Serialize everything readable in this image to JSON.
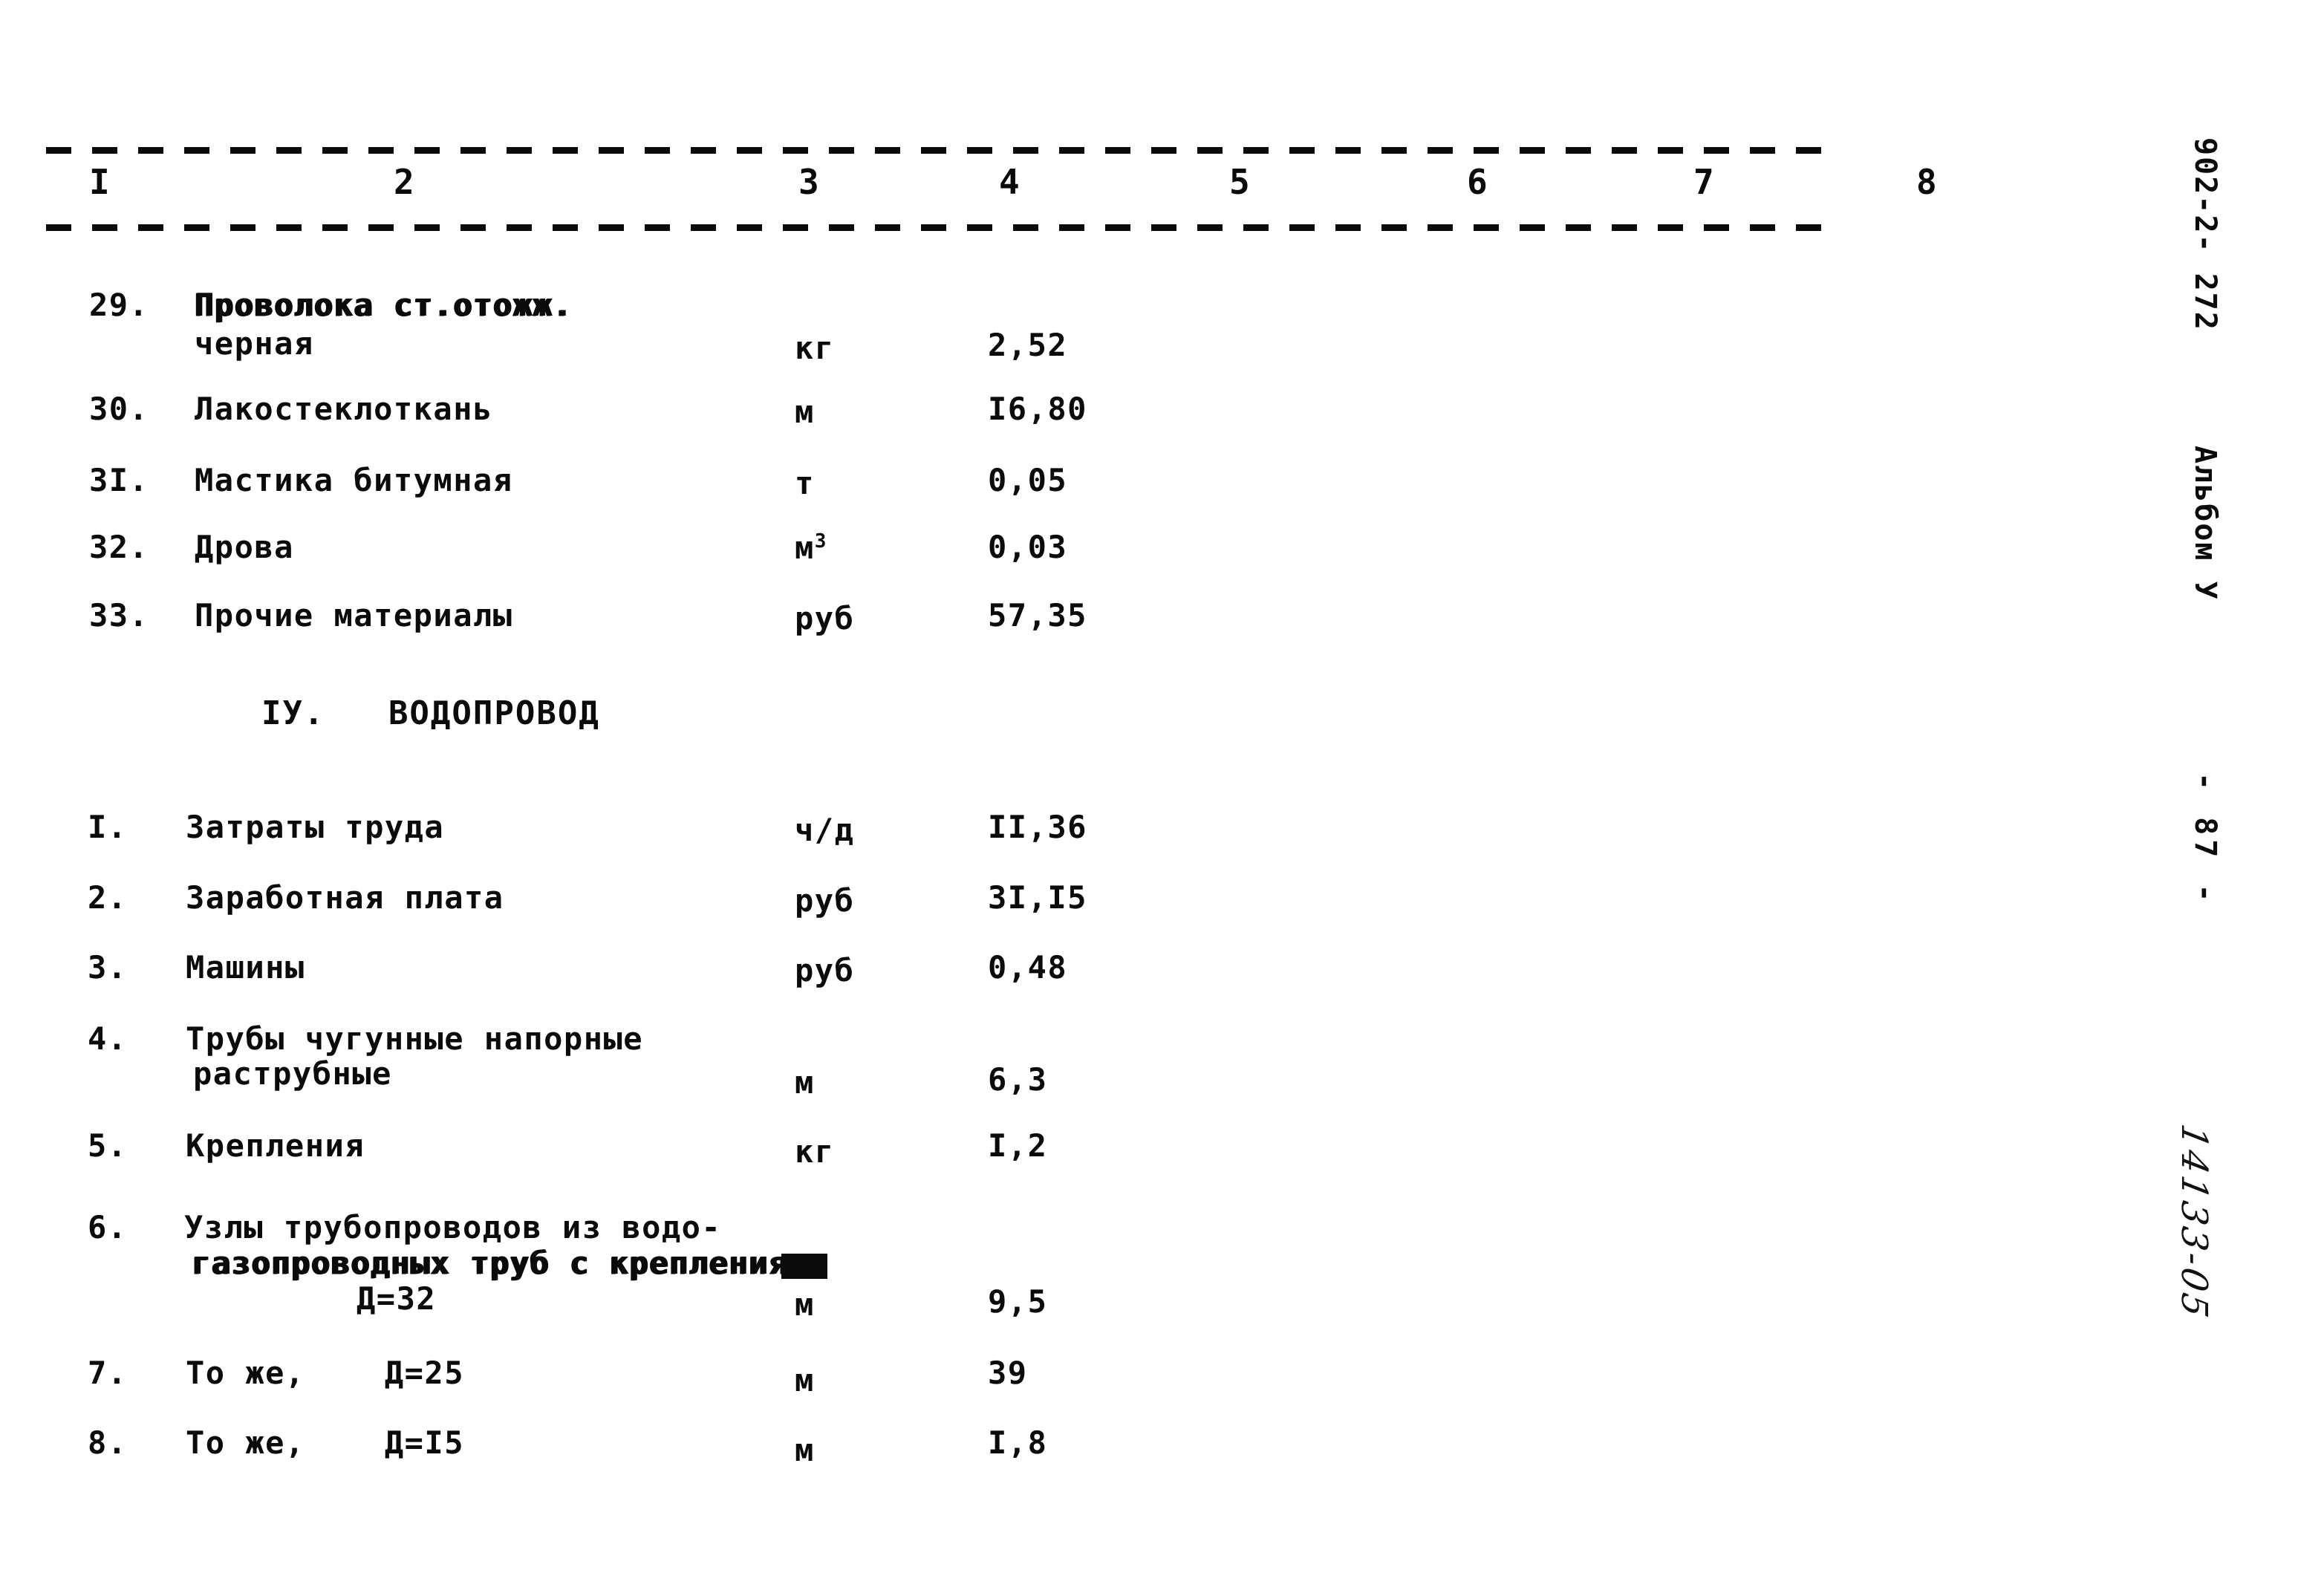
{
  "document": {
    "column_headers": [
      "I",
      "2",
      "3",
      "4",
      "5",
      "6",
      "7",
      "8"
    ],
    "section_heading": "IУ.   ВОДОПРОВОД",
    "rows_before_section": [
      {
        "num": "29.",
        "name_line1": "Проволока ст.отожж.",
        "name_line2": "черная",
        "unit": "кг",
        "unit_sup": "",
        "value": "2,52"
      },
      {
        "num": "30.",
        "name_line1": "Лакостеклоткань",
        "name_line2": "",
        "unit": "м",
        "unit_sup": "",
        "value": "I6,80"
      },
      {
        "num": "3I.",
        "name_line1": "Мастика битумная",
        "name_line2": "",
        "unit": "т",
        "unit_sup": "",
        "value": "0,05"
      },
      {
        "num": "32.",
        "name_line1": "Дрова",
        "name_line2": "",
        "unit": "м",
        "unit_sup": "3",
        "value": "0,03"
      },
      {
        "num": "33.",
        "name_line1": "Прочие материалы",
        "name_line2": "",
        "unit": "руб",
        "unit_sup": "",
        "value": "57,35"
      }
    ],
    "rows_after_section": [
      {
        "num": "I.",
        "name_line1": "Затраты труда",
        "name_line2": "",
        "name_line3": "",
        "unit": "ч/д",
        "unit_sup": "",
        "value": "II,36"
      },
      {
        "num": "2.",
        "name_line1": "Заработная плата",
        "name_line2": "",
        "name_line3": "",
        "unit": "руб",
        "unit_sup": "",
        "value": "3I,I5"
      },
      {
        "num": "3.",
        "name_line1": "Машины",
        "name_line2": "",
        "name_line3": "",
        "unit": "руб",
        "unit_sup": "",
        "value": "0,48"
      },
      {
        "num": "4.",
        "name_line1": "Трубы чугунные напорные",
        "name_line2": "раструбные",
        "name_line3": "",
        "unit": "м",
        "unit_sup": "",
        "value": "6,3"
      },
      {
        "num": "5.",
        "name_line1": "Крепления",
        "name_line2": "",
        "name_line3": "",
        "unit": "кг",
        "unit_sup": "",
        "value": "I,2"
      },
      {
        "num": "6.",
        "name_line1": "Узлы трубопроводов из водо-",
        "name_line2": "газопроводных труб с креплениями",
        "name_line3": "Д=32",
        "unit": "м",
        "unit_sup": "",
        "value": "9,5"
      },
      {
        "num": "7.",
        "name_line1": "То же,    Д=25",
        "name_line2": "",
        "name_line3": "",
        "unit": "м",
        "unit_sup": "",
        "value": "39"
      },
      {
        "num": "8.",
        "name_line1": "То же,    Д=I5",
        "name_line2": "",
        "name_line3": "",
        "unit": "м",
        "unit_sup": "",
        "value": "I,8"
      }
    ],
    "margin": {
      "code": "902-2- 272",
      "album": "Альбом У",
      "page": "- 87 -",
      "handwritten_note": "14133-05"
    }
  }
}
